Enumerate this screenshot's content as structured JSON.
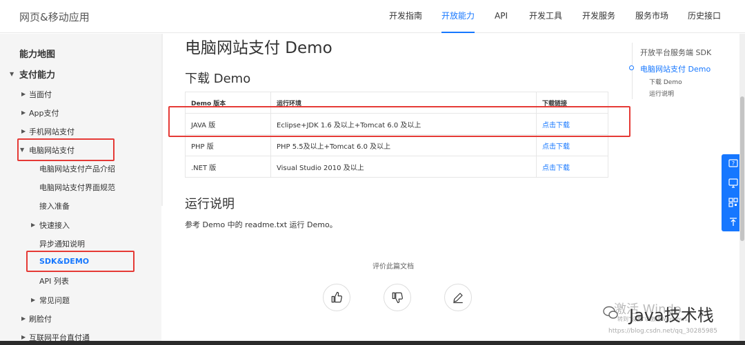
{
  "header": {
    "logo": "网页&移动应用",
    "nav": [
      "开发指南",
      "开放能力",
      "API",
      "开发工具",
      "开发服务",
      "服务市场",
      "历史接口"
    ],
    "active_nav": "开放能力"
  },
  "sidebar": {
    "items": [
      {
        "label": "能力地图"
      },
      {
        "label": "支付能力"
      },
      {
        "label": "当面付"
      },
      {
        "label": "App支付"
      },
      {
        "label": "手机网站支付"
      },
      {
        "label": "电脑网站支付"
      },
      {
        "label": "电脑网站支付产品介绍"
      },
      {
        "label": "电脑网站支付界面规范"
      },
      {
        "label": "接入准备"
      },
      {
        "label": "快速接入"
      },
      {
        "label": "异步通知说明"
      },
      {
        "label": "SDK&DEMO"
      },
      {
        "label": "API 列表"
      },
      {
        "label": "常见问题"
      },
      {
        "label": "刷脸付"
      },
      {
        "label": "互联网平台直付通"
      }
    ]
  },
  "main": {
    "title": "电脑网站支付 Demo",
    "download_heading": "下载 Demo",
    "table": {
      "headers": [
        "Demo 版本",
        "运行环境",
        "下载链接"
      ],
      "rows": [
        [
          "JAVA 版",
          "Eclipse+JDK 1.6 及以上+Tomcat 6.0 及以上",
          "点击下载"
        ],
        [
          "PHP 版",
          "PHP 5.5及以上+Tomcat 6.0 及以上",
          "点击下载"
        ],
        [
          ".NET 版",
          "Visual Studio 2010 及以上",
          "点击下载"
        ]
      ]
    },
    "run_heading": "运行说明",
    "run_text": "参考 Demo 中的 readme.txt 运行 Demo。",
    "rate_label": "评价此篇文档"
  },
  "toc": {
    "items": [
      "开放平台服务端 SDK",
      "电脑网站支付 Demo",
      "下载 Demo",
      "运行说明"
    ]
  },
  "watermark": {
    "main": "Java技术栈",
    "faded": "激活 Windo",
    "sub": "转到\"设置\"以激活 Windows。",
    "url": "https://blog.csdn.net/qq_30285985"
  },
  "colors": {
    "accent": "#1677ff",
    "highlight": "#e53935"
  }
}
